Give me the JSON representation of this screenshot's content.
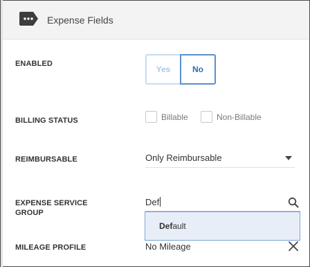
{
  "header": {
    "title": "Expense Fields",
    "icon": "tag-icon"
  },
  "enabled": {
    "label": "ENABLED",
    "options": [
      "Yes",
      "No"
    ],
    "selected": "No"
  },
  "billing_status": {
    "label": "BILLING STATUS",
    "options": [
      "Billable",
      "Non-Billable"
    ]
  },
  "reimbursable": {
    "label": "REIMBURSABLE",
    "value": "Only Reimbursable"
  },
  "expense_service_group": {
    "label_line1": "EXPENSE SERVICE",
    "label_line2": "GROUP",
    "input_value": "Def",
    "suggestion_match": "Def",
    "suggestion_rest": "ault"
  },
  "mileage_profile": {
    "label": "MILEAGE PROFILE",
    "value": "No Mileage"
  },
  "colors": {
    "accent": "#5b8fd0",
    "header_bg": "#f3f3f3",
    "dropdown_bg": "#e8eef8",
    "toggle_inactive": "#a9c8e6"
  }
}
